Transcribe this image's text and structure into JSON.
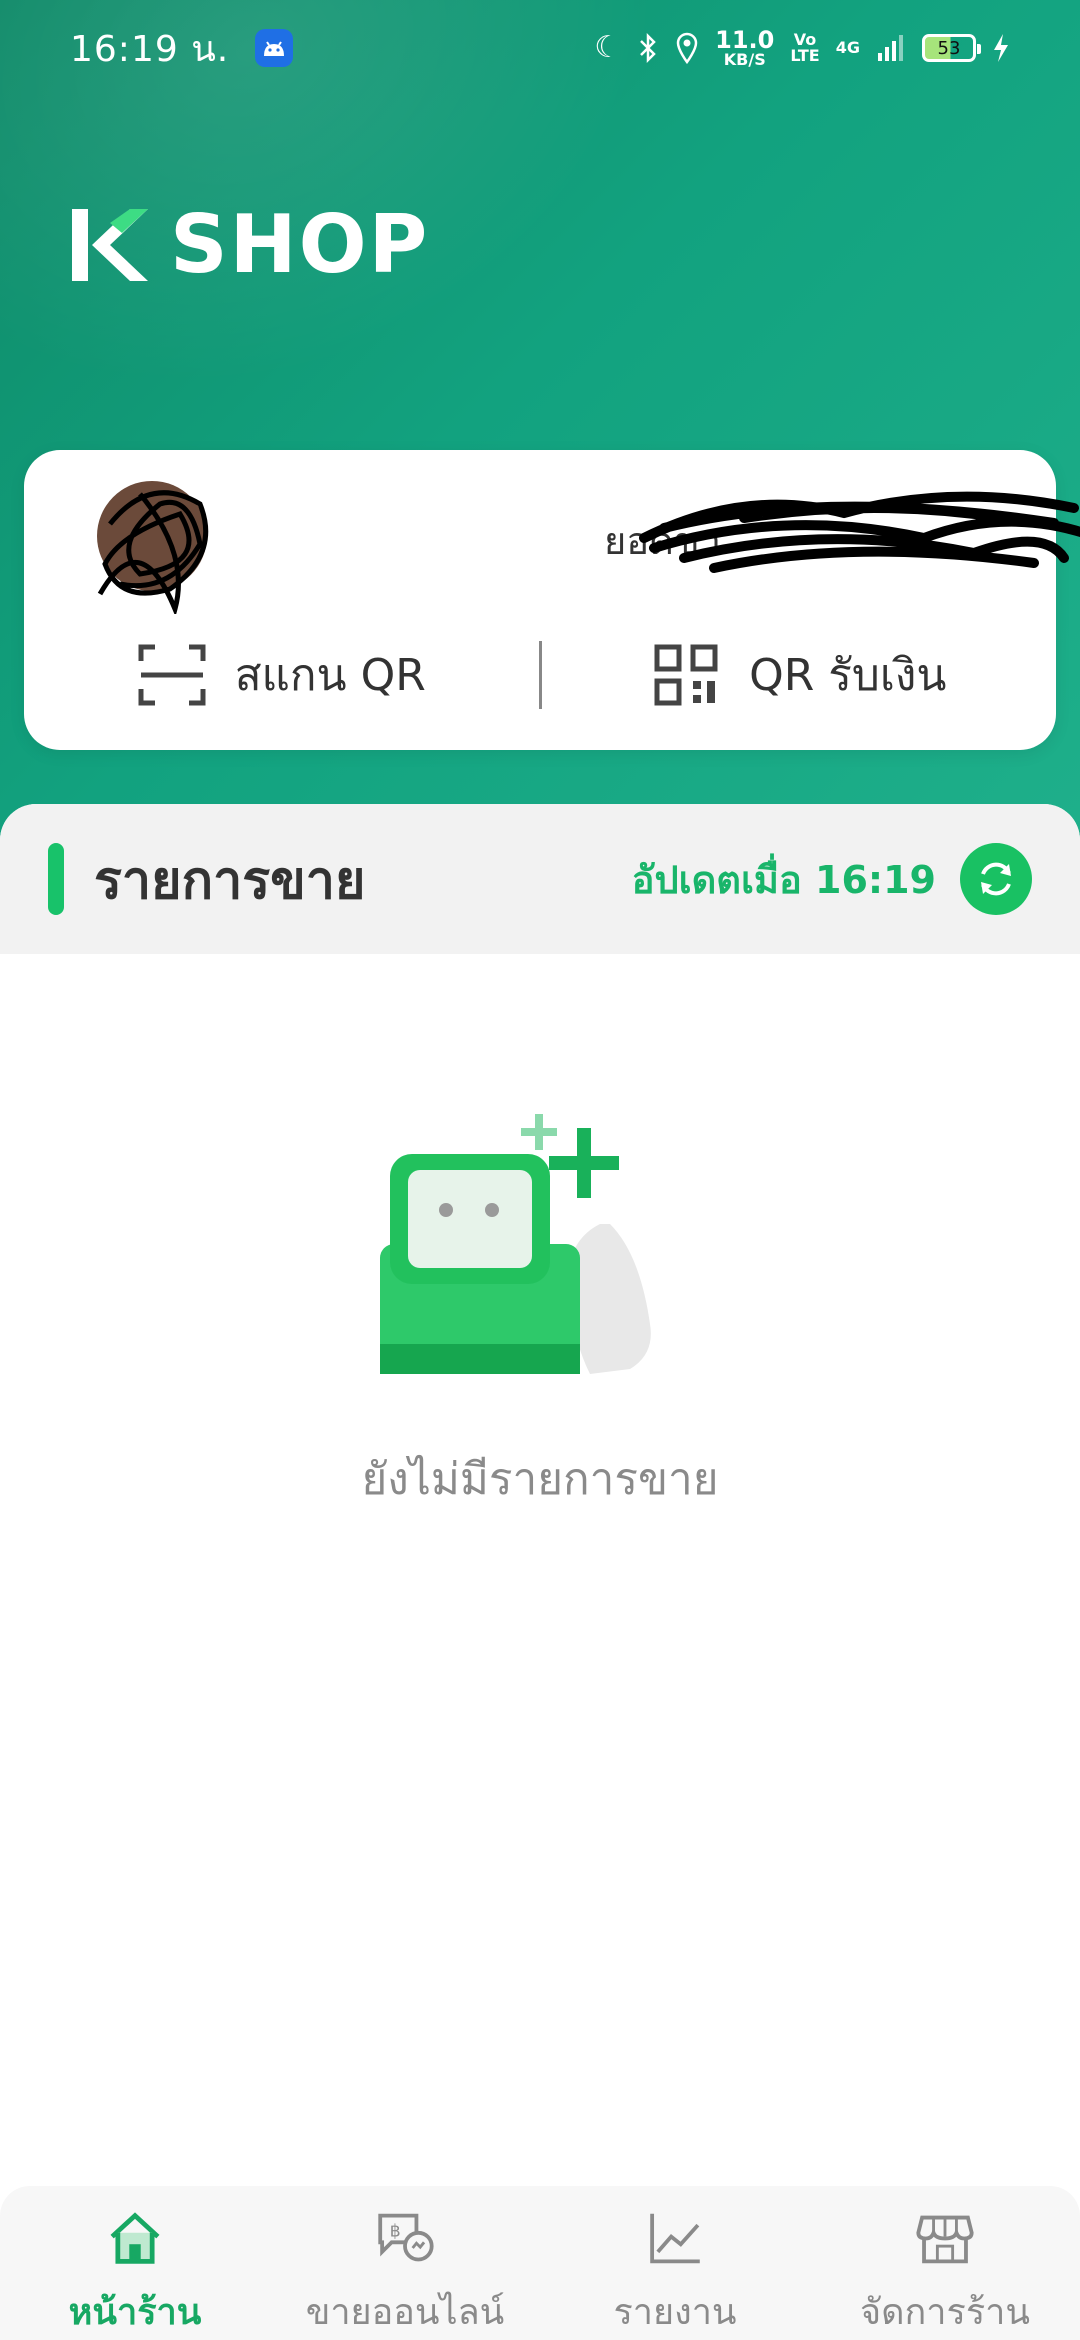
{
  "status_bar": {
    "time": "16:19 น.",
    "net_speed_value": "11.0",
    "net_speed_unit": "KB/S",
    "volte_top": "Vo",
    "volte_bottom": "LTE",
    "signal": "4G",
    "battery": "53"
  },
  "header": {
    "logo_text": "SHOP",
    "logo_mark": "K"
  },
  "shop_card": {
    "sales_label": "ยอดขา",
    "scan_qr_label": "สแกน QR",
    "receive_qr_label": "QR รับเงิน"
  },
  "sales_list": {
    "title": "รายการขาย",
    "updated_label": "อัปเดตเมื่อ 16:19",
    "empty_message": "ยังไม่มีรายการขาย"
  },
  "bottom_nav": {
    "items": [
      {
        "label": "หน้าร้าน",
        "icon": "home-icon",
        "active": true
      },
      {
        "label": "ขายออนไลน์",
        "icon": "online-sale-chat-icon",
        "active": false
      },
      {
        "label": "รายงาน",
        "icon": "report-chart-icon",
        "active": false
      },
      {
        "label": "จัดการร้าน",
        "icon": "store-icon",
        "active": false
      }
    ]
  },
  "colors": {
    "brand_green": "#12a27f",
    "accent_green": "#18c26a",
    "active_nav": "#17a863"
  }
}
